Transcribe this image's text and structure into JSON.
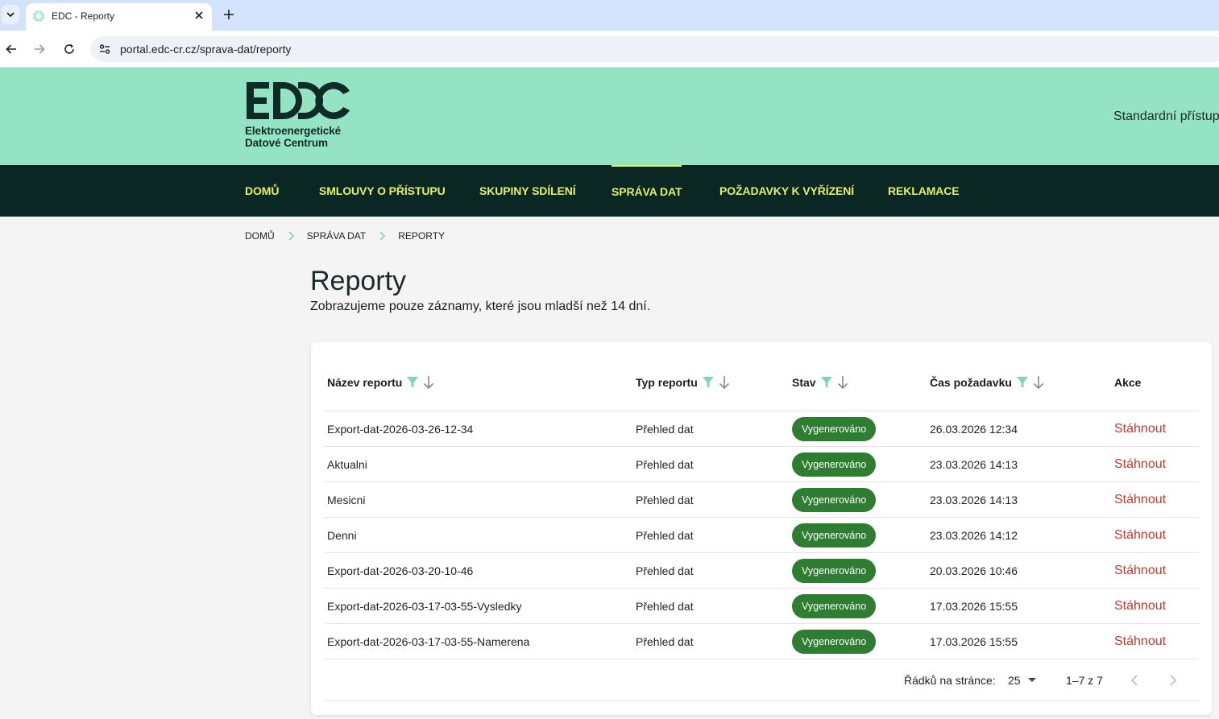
{
  "browser": {
    "tab_title": "EDC - Reporty",
    "url": "portal.edc-cr.cz/sprava-dat/reporty"
  },
  "header": {
    "logo_lines": [
      "Elektroenergetické",
      "Datové Centrum"
    ],
    "access_label": "Standardní přístup"
  },
  "nav": {
    "items": [
      "DOMŮ",
      "SMLOUVY O PŘÍSTUPU",
      "SKUPINY SDÍLENÍ",
      "SPRÁVA DAT",
      "POŽADAVKY K VYŘÍZENÍ",
      "REKLAMACE"
    ],
    "active": "SPRÁVA DAT"
  },
  "breadcrumb": [
    "DOMŮ",
    "SPRÁVA DAT",
    "REPORTY"
  ],
  "page": {
    "title": "Reporty",
    "subtitle": "Zobrazujeme pouze záznamy, které jsou mladší než 14 dní."
  },
  "table": {
    "columns": [
      "Název reportu",
      "Typ reportu",
      "Stav",
      "Čas požadavku",
      "Akce"
    ],
    "rows": [
      {
        "name": "Export-dat-2026-03-26-12-34",
        "type": "Přehled dat",
        "status": "Vygenerováno",
        "time": "26.03.2026 12:34",
        "action": "Stáhnout"
      },
      {
        "name": "Aktualni",
        "type": "Přehled dat",
        "status": "Vygenerováno",
        "time": "23.03.2026 14:13",
        "action": "Stáhnout"
      },
      {
        "name": "Mesicni",
        "type": "Přehled dat",
        "status": "Vygenerováno",
        "time": "23.03.2026 14:13",
        "action": "Stáhnout"
      },
      {
        "name": "Denni",
        "type": "Přehled dat",
        "status": "Vygenerováno",
        "time": "23.03.2026 14:12",
        "action": "Stáhnout"
      },
      {
        "name": "Export-dat-2026-03-20-10-46",
        "type": "Přehled dat",
        "status": "Vygenerováno",
        "time": "20.03.2026 10:46",
        "action": "Stáhnout"
      },
      {
        "name": "Export-dat-2026-03-17-03-55-Vysledky",
        "type": "Přehled dat",
        "status": "Vygenerováno",
        "time": "17.03.2026 15:55",
        "action": "Stáhnout"
      },
      {
        "name": "Export-dat-2026-03-17-03-55-Namerena",
        "type": "Přehled dat",
        "status": "Vygenerováno",
        "time": "17.03.2026 15:55",
        "action": "Stáhnout"
      }
    ]
  },
  "pagination": {
    "rows_per_page_label": "Řádků na stránce:",
    "rows_per_page_value": "25",
    "range": "1–7 z 7"
  },
  "colors": {
    "header_bg": "#94e3c4",
    "nav_bg": "#0b2724",
    "nav_text": "#e4f06a",
    "badge": "#2e7d32",
    "action_link": "#c0392b",
    "filter_icon": "#7ed6b4"
  }
}
